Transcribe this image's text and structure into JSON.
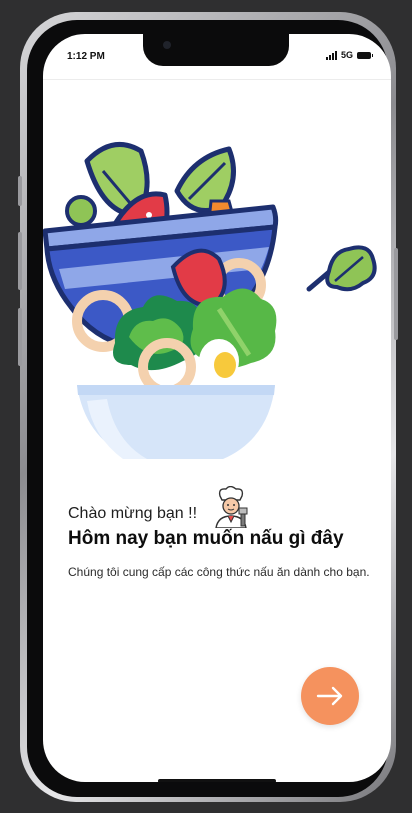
{
  "status_bar": {
    "time": "1:12 PM",
    "network": "5G"
  },
  "onboarding": {
    "greeting": "Chào mừng bạn !!",
    "title": "Hôm nay bạn muốn nấu gì đây",
    "description": "Chúng tôi cung cấp các công thức nấu ăn dành cho bạn."
  },
  "icons": {
    "illustration": "salad-bowl-illustration",
    "chef": "chef-icon",
    "next": "arrow-right-icon",
    "leaf": "lettuce-leaf-icon"
  },
  "colors": {
    "accent": "#f5925e",
    "title": "#0d0d0d",
    "screen": "#ffffff"
  }
}
